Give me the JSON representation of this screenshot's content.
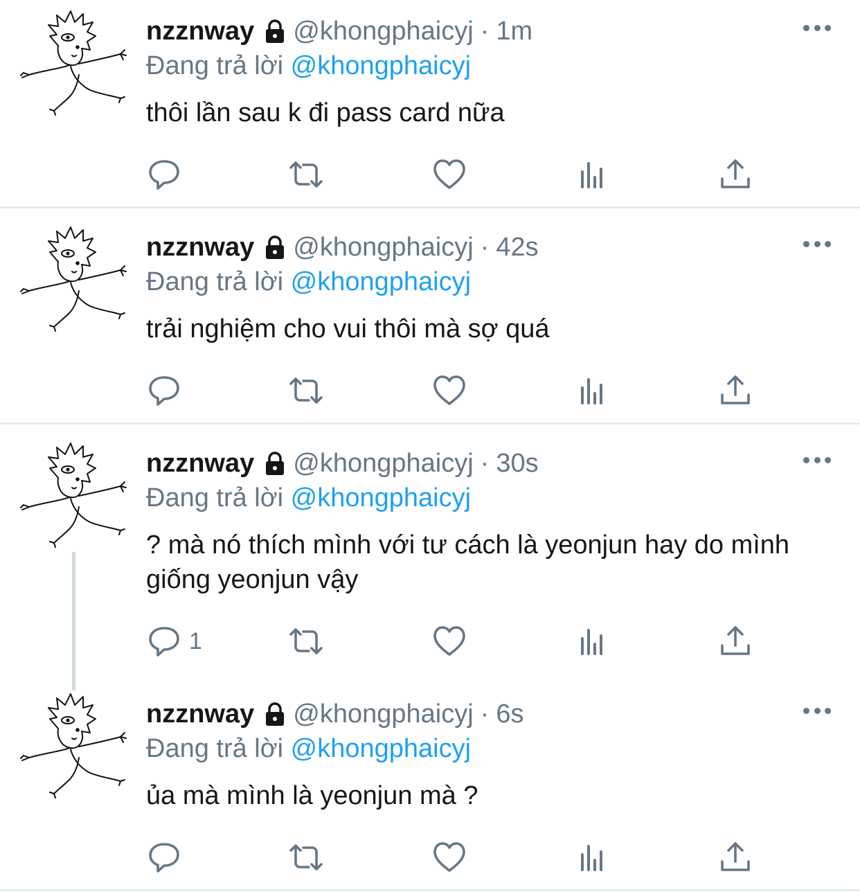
{
  "tweets": [
    {
      "display_name": "nzznway",
      "handle": "@khongphaicyj",
      "time": "1m",
      "reply_prefix": "Đang trả lời",
      "reply_to": "@khongphaicyj",
      "text": "thôi lần sau k đi pass card nữa",
      "reply_count": ""
    },
    {
      "display_name": "nzznway",
      "handle": "@khongphaicyj",
      "time": "42s",
      "reply_prefix": "Đang trả lời",
      "reply_to": "@khongphaicyj",
      "text": "trải nghiệm cho vui thôi mà sợ quá",
      "reply_count": ""
    },
    {
      "display_name": "nzznway",
      "handle": "@khongphaicyj",
      "time": "30s",
      "reply_prefix": "Đang trả lời",
      "reply_to": "@khongphaicyj",
      "text": "? mà nó thích mình với tư cách là yeonjun hay do mình giống yeonjun vậy",
      "reply_count": "1"
    },
    {
      "display_name": "nzznway",
      "handle": "@khongphaicyj",
      "time": "6s",
      "reply_prefix": "Đang trả lời",
      "reply_to": "@khongphaicyj",
      "text": "ủa mà mình là yeonjun mà ?",
      "reply_count": ""
    }
  ],
  "separator": "·",
  "icons": {
    "reply": "reply-icon",
    "retweet": "retweet-icon",
    "like": "heart-icon",
    "analytics": "analytics-icon",
    "share": "share-icon",
    "protected": "lock-icon",
    "more": "more-icon"
  },
  "colors": {
    "text": "#14171a",
    "muted": "#657786",
    "link": "#1da1f2",
    "divider": "#e6ecf0"
  }
}
